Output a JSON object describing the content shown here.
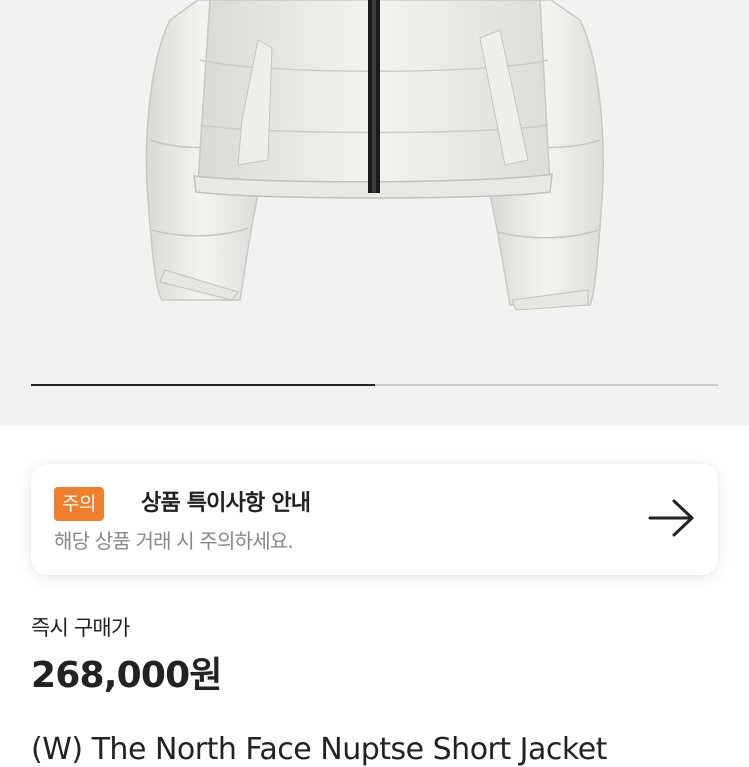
{
  "product_image": {
    "alt": "product-photo",
    "icon": "jacket-image"
  },
  "gallery": {
    "progress": 0.5
  },
  "notice": {
    "badge": "주의",
    "title": "상품 특이사항 안내",
    "subtitle": "해당 상품 거래 시 주의하세요.",
    "icon": "arrow-right-icon"
  },
  "price_section": {
    "label": "즉시 구매가",
    "price": "268,000원"
  },
  "product": {
    "title": "(W) The North Face Nuptse Short Jacket"
  },
  "colors": {
    "badge": "#f07e2b",
    "background": "#f2f2f1"
  }
}
